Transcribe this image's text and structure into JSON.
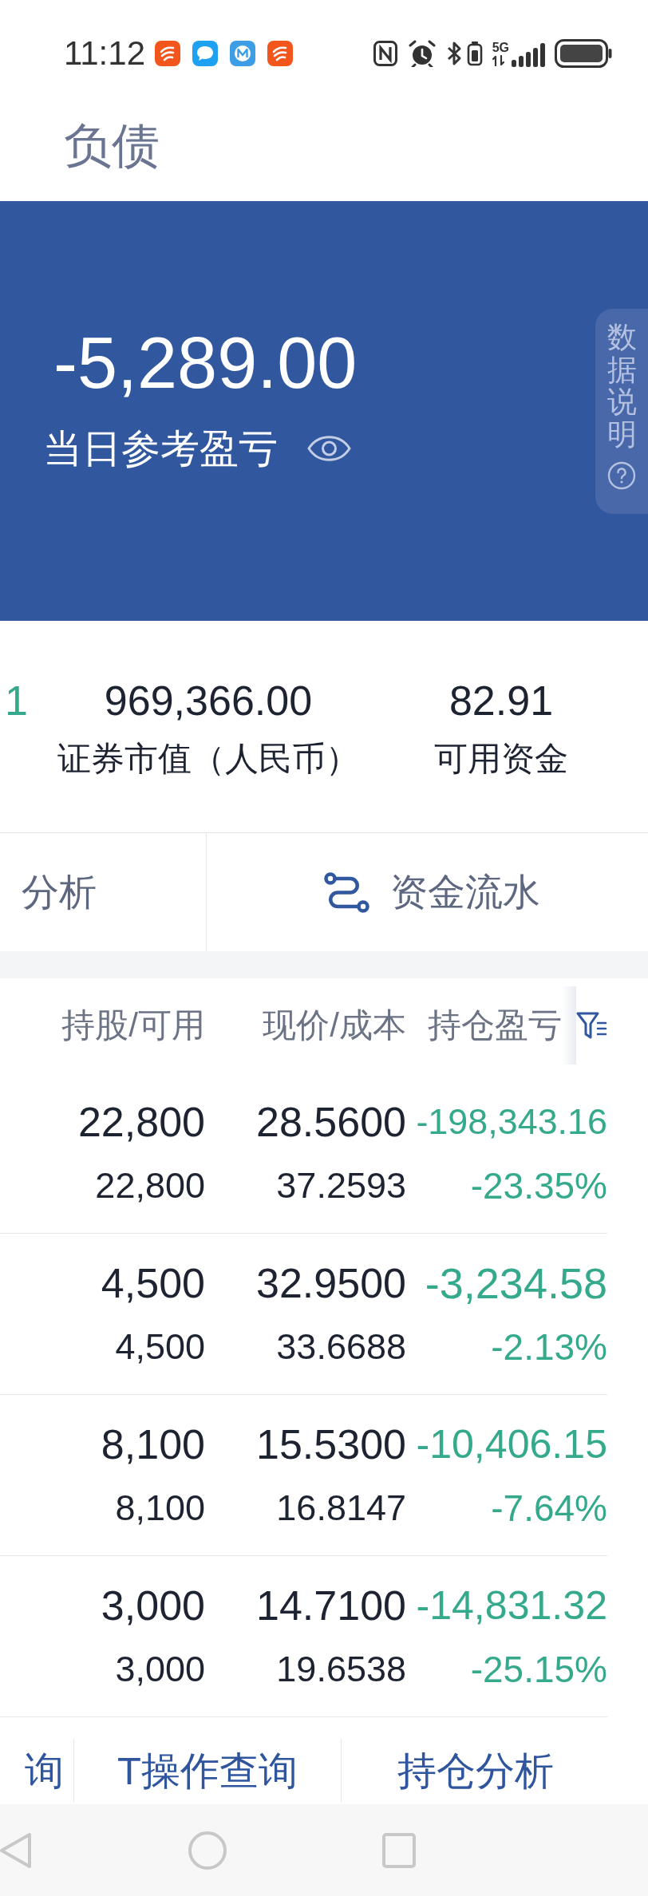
{
  "status_bar": {
    "time": "11:12",
    "network": "5G"
  },
  "header": {
    "tabs": [
      {
        "label": "负债",
        "selected": false
      }
    ]
  },
  "summary": {
    "value": "-5,289.00",
    "label": "当日参考盈亏",
    "info_tab": "数据说明"
  },
  "stats": [
    {
      "value": "1",
      "color": "#34a98b"
    },
    {
      "value": "969,366.00",
      "label": "证券市值（人民币）",
      "color": "#1d2330"
    },
    {
      "value": "82.91",
      "label": "可用资金",
      "color": "#1d2330"
    }
  ],
  "actions": [
    {
      "label": "分析",
      "kind": "plain"
    },
    {
      "label": "资金流水",
      "kind": "route"
    }
  ],
  "table": {
    "columns": [
      "持股/可用",
      "现价/成本",
      "持仓盈亏"
    ],
    "rows": [
      {
        "holding": "22,800",
        "available": "22,800",
        "price": "28.5600",
        "cost": "37.2593",
        "pnl": "-198,343.16",
        "pnl_pct": "-23.35%",
        "color": "#34a98b"
      },
      {
        "holding": "4,500",
        "available": "4,500",
        "price": "32.9500",
        "cost": "33.6688",
        "pnl": "-3,234.58",
        "pnl_pct": "-2.13%",
        "color": "#34a98b"
      },
      {
        "holding": "8,100",
        "available": "8,100",
        "price": "15.5300",
        "cost": "16.8147",
        "pnl": "-10,406.15",
        "pnl_pct": "-7.64%",
        "color": "#34a98b"
      },
      {
        "holding": "3,000",
        "available": "3,000",
        "price": "14.7100",
        "cost": "19.6538",
        "pnl": "-14,831.32",
        "pnl_pct": "-25.15%",
        "color": "#34a98b"
      }
    ]
  },
  "bottom_tabs": [
    {
      "label": "询"
    },
    {
      "label": "T操作查询"
    },
    {
      "label": "持仓分析"
    }
  ]
}
